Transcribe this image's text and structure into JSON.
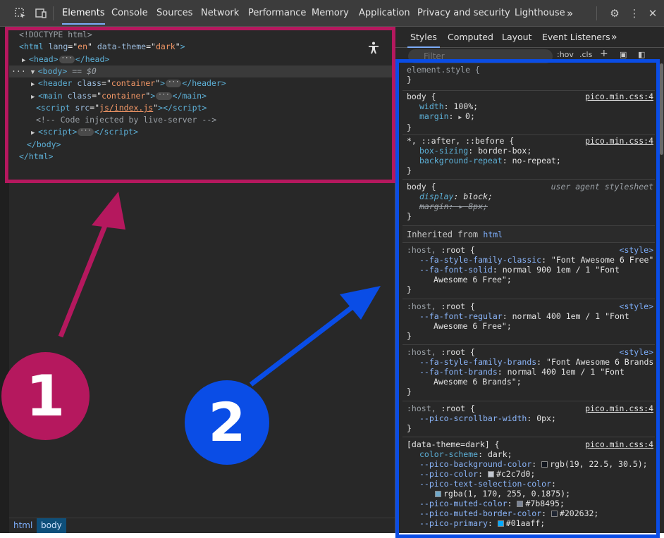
{
  "toolbar": {
    "tabs": [
      "Elements",
      "Console",
      "Sources",
      "Network",
      "Performance",
      "Memory",
      "Application",
      "Privacy and security",
      "Lighthouse"
    ],
    "more": "»"
  },
  "elements": {
    "doctype": "<!DOCTYPE html>",
    "html_open": {
      "tag": "html",
      "attrs": [
        [
          "lang",
          "en"
        ],
        [
          "data-theme",
          "dark"
        ]
      ]
    },
    "head": "head",
    "body_tag": "body",
    "body_marker": " == $0",
    "header": {
      "tag": "header",
      "attr": "class",
      "val": "container"
    },
    "main": {
      "tag": "main",
      "attr": "class",
      "val": "container"
    },
    "script_src": {
      "attr": "src",
      "val": "js/index.js"
    },
    "comment": "<!-- Code injected by live-server -->",
    "script2": "script",
    "body_close": "</body>",
    "html_close": "</html>"
  },
  "breadcrumbs": [
    "html",
    "body"
  ],
  "styles_tabs": [
    "Styles",
    "Computed",
    "Layout",
    "Event Listeners"
  ],
  "filter": {
    "placeholder": "Filter",
    "hov": ":hov",
    "cls": ".cls"
  },
  "rules": [
    {
      "selector": "element.style {",
      "source": ""
    },
    {
      "selector": "body {",
      "source": "pico.min.css:4",
      "decls": [
        [
          "width",
          "100%;"
        ],
        [
          "margin",
          "0;"
        ]
      ]
    },
    {
      "selector": "*, ::after, ::before {",
      "source": "pico.min.css:4",
      "decls": [
        [
          "box-sizing",
          "border-box;"
        ],
        [
          "background-repeat",
          "no-repeat;"
        ]
      ]
    },
    {
      "selector": "body {",
      "source": "user agent stylesheet",
      "decls": [
        [
          "display",
          "block;"
        ],
        [
          "margin",
          "8px;"
        ]
      ]
    },
    {
      "inherited_label": "Inherited from",
      "inherited_tag": "html"
    },
    {
      "selector": ":host, :root {",
      "source": "<style>",
      "decls": [
        [
          "--fa-style-family-classic",
          "\"Font Awesome 6 Free\";"
        ],
        [
          "--fa-font-solid",
          "normal 900 1em / 1 \"Font Awesome 6 Free\";"
        ]
      ]
    },
    {
      "selector": ":host, :root {",
      "source": "<style>",
      "decls": [
        [
          "--fa-font-regular",
          "normal 400 1em / 1 \"Font Awesome 6 Free\";"
        ]
      ]
    },
    {
      "selector": ":host, :root {",
      "source": "<style>",
      "decls": [
        [
          "--fa-style-family-brands",
          "\"Font Awesome 6 Brands\";"
        ],
        [
          "--fa-font-brands",
          "normal 400 1em / 1 \"Font Awesome 6 Brands\";"
        ]
      ]
    },
    {
      "selector": ":host, :root {",
      "source": "pico.min.css:4",
      "decls": [
        [
          "--pico-scrollbar-width",
          "0px;"
        ]
      ]
    },
    {
      "selector": "[data-theme=dark] {",
      "source": "pico.min.css:4",
      "decls": [
        [
          "color-scheme",
          "dark;"
        ],
        [
          "--pico-background-color",
          "rgb(19, 22.5, 30.5);"
        ],
        [
          "--pico-color",
          "#c2c7d0;"
        ],
        [
          "--pico-text-selection-color",
          "rgba(1, 170, 255, 0.1875);"
        ],
        [
          "--pico-muted-color",
          "#7b8495;"
        ],
        [
          "--pico-muted-border-color",
          "#202632;"
        ],
        [
          "--pico-primary",
          "#01aaff;"
        ]
      ]
    }
  ],
  "swatches": {
    "bg": "#13171f",
    "color": "#c2c7d0",
    "selection": "#01aaff",
    "muted": "#7b8495",
    "muted_border": "#202632",
    "primary": "#01aaff"
  },
  "annotations": [
    {
      "label": "1",
      "color": "#b5185e"
    },
    {
      "label": "2",
      "color": "#0a4de6"
    }
  ]
}
